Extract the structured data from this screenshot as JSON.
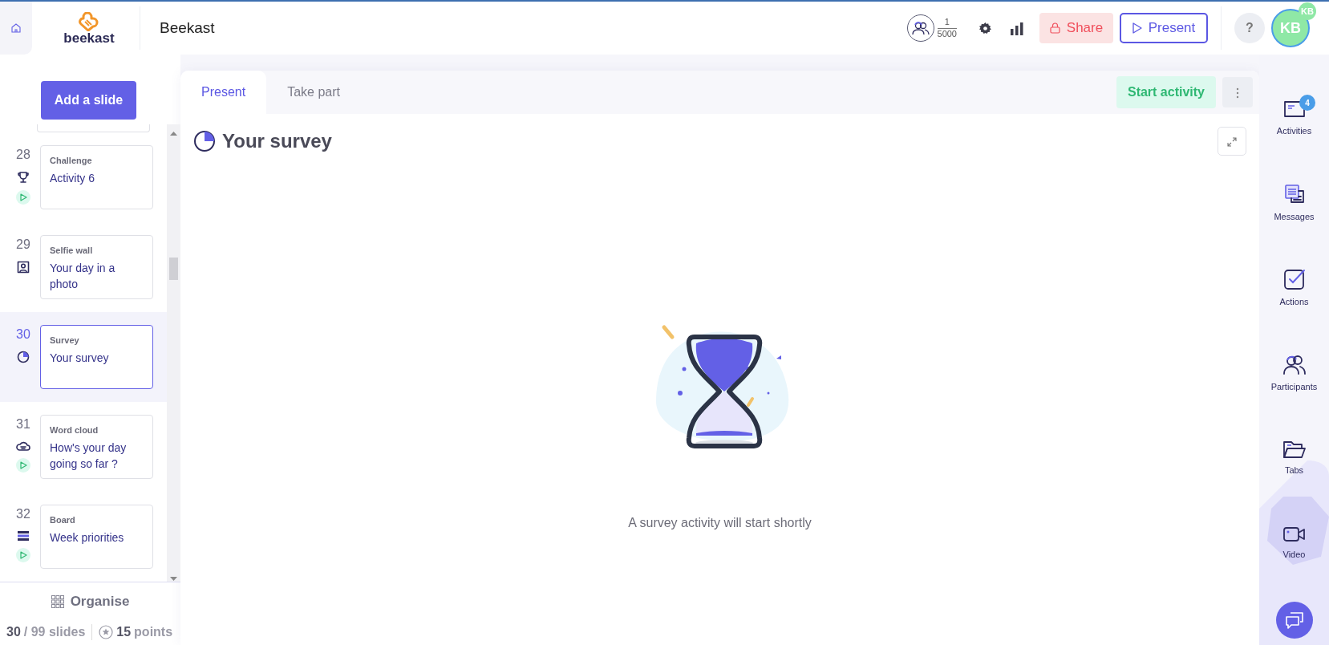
{
  "header": {
    "logo_text": "beekast",
    "title": "Beekast",
    "participants": {
      "current": "1",
      "max": "5000"
    },
    "share": "Share",
    "present": "Present",
    "help": "?",
    "avatar": "KB",
    "avatar_badge": "KB"
  },
  "sidebar": {
    "add_button": "Add a slide",
    "slides": [
      {
        "number": "28",
        "kind": "challenge",
        "type": "Challenge",
        "title": "Activity 6",
        "playable": true,
        "selected": false
      },
      {
        "number": "29",
        "kind": "selfie",
        "type": "Selfie wall",
        "title": "Your day in a photo",
        "playable": false,
        "selected": false
      },
      {
        "number": "30",
        "kind": "survey",
        "type": "Survey",
        "title": "Your survey",
        "playable": false,
        "selected": true
      },
      {
        "number": "31",
        "kind": "wordcloud",
        "type": "Word cloud",
        "title": "How's your day going so far ?",
        "playable": true,
        "selected": false
      },
      {
        "number": "32",
        "kind": "board",
        "type": "Board",
        "title": "Week priorities",
        "playable": true,
        "selected": false
      }
    ],
    "organise": "Organise",
    "footer": {
      "current": "30",
      "total": "/ 99 slides",
      "points": "15",
      "points_label": "points"
    }
  },
  "main": {
    "tabs": [
      {
        "label": "Present",
        "selected": true
      },
      {
        "label": "Take part",
        "selected": false
      }
    ],
    "start_button": "Start activity",
    "title": "Your survey",
    "message": "A survey activity will start shortly"
  },
  "rail": {
    "items": [
      {
        "kind": "activities",
        "label": "Activities",
        "badge": "4"
      },
      {
        "kind": "messages",
        "label": "Messages"
      },
      {
        "kind": "actions",
        "label": "Actions"
      },
      {
        "kind": "participants",
        "label": "Participants"
      },
      {
        "kind": "tabs",
        "label": "Tabs"
      },
      {
        "kind": "video",
        "label": "Video"
      }
    ]
  }
}
